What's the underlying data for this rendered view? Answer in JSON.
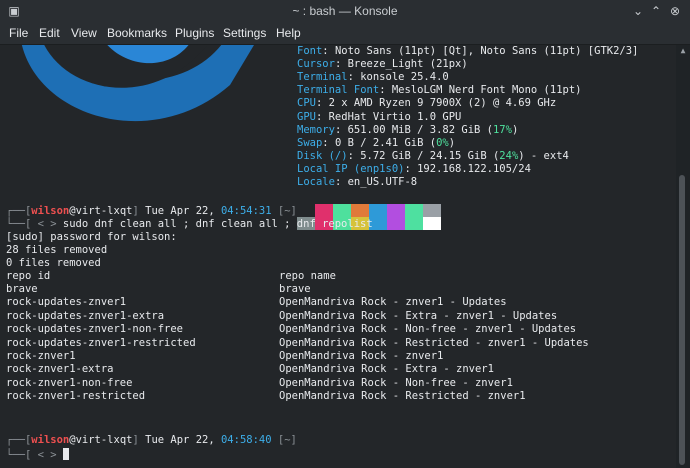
{
  "window": {
    "title": "~ : bash — Konsole"
  },
  "menu": [
    "File",
    "Edit",
    "View",
    "Bookmarks",
    "Plugins",
    "Settings",
    "Help"
  ],
  "fetch": [
    {
      "key": "Font",
      "value": ": Noto Sans (11pt) [Qt], Noto Sans (11pt) [GTK2/3]"
    },
    {
      "key": "Cursor",
      "value": ": Breeze_Light (21px)"
    },
    {
      "key": "Terminal",
      "value": ": konsole 25.4.0"
    },
    {
      "key": "Terminal Font",
      "value": ": MesloLGM Nerd Font Mono (11pt)"
    },
    {
      "key": "CPU",
      "value": ": 2 x AMD Ryzen 9 7900X (2) @ 4.69 GHz"
    },
    {
      "key": "GPU",
      "value": ": RedHat Virtio 1.0 GPU"
    },
    {
      "key": "Memory",
      "value": ": 651.00 MiB / 3.82 GiB (",
      "pct": "17%",
      "tail": ")"
    },
    {
      "key": "Swap",
      "value": ": 0 B / 2.41 GiB (",
      "pct": "0%",
      "tail": ")"
    },
    {
      "key": "Disk (/)",
      "value": ": 5.72 GiB / 24.15 GiB (",
      "pct": "24%",
      "tail": ") - ext4"
    },
    {
      "key": "Local IP (enp1s0)",
      "value": ": 192.168.122.105/24"
    },
    {
      "key": "Locale",
      "value": ": en_US.UTF-8"
    }
  ],
  "palette": {
    "top": [
      "#232629",
      "#e0306c",
      "#4ee09d",
      "#e07a3a",
      "#2e9ad8",
      "#b24ee0",
      "#4ee0a0",
      "#9aa0a6"
    ],
    "bottom": [
      "#7f8c8d",
      "#e0306c",
      "#4ee09d",
      "#d6c23a",
      "#2e9ad8",
      "#b24ee0",
      "#4ee0a0",
      "#ffffff"
    ]
  },
  "prompt1": {
    "corner": "┌──[",
    "user": "wilson",
    "at": "@",
    "host": "virt-lxqt",
    "close": "]",
    "date": " Tue Apr 22, ",
    "time": "04:54:31",
    "dir": " [~]",
    "cmd_prefix": "└──[ < > ",
    "cmd": "sudo dnf clean all ; dnf clean all ; dnf repolist"
  },
  "output": [
    "[sudo] password for wilson:",
    "28 files removed",
    "0 files removed"
  ],
  "repolist": {
    "header": {
      "id": "repo id",
      "name": "repo name"
    },
    "rows": [
      {
        "id": "brave",
        "name": "brave"
      },
      {
        "id": "rock-updates-znver1",
        "name": "OpenMandriva Rock - znver1 - Updates"
      },
      {
        "id": "rock-updates-znver1-extra",
        "name": "OpenMandriva Rock - Extra - znver1 - Updates"
      },
      {
        "id": "rock-updates-znver1-non-free",
        "name": "OpenMandriva Rock - Non-free - znver1 - Updates"
      },
      {
        "id": "rock-updates-znver1-restricted",
        "name": "OpenMandriva Rock - Restricted - znver1 - Updates"
      },
      {
        "id": "rock-znver1",
        "name": "OpenMandriva Rock - znver1"
      },
      {
        "id": "rock-znver1-extra",
        "name": "OpenMandriva Rock - Extra - znver1"
      },
      {
        "id": "rock-znver1-non-free",
        "name": "OpenMandriva Rock - Non-free - znver1"
      },
      {
        "id": "rock-znver1-restricted",
        "name": "OpenMandriva Rock - Restricted - znver1"
      }
    ]
  },
  "prompt2": {
    "corner": "┌──[",
    "user": "wilson",
    "at": "@",
    "host": "virt-lxqt",
    "close": "]",
    "date": " Tue Apr 22, ",
    "time": "04:58:40",
    "dir": " [~]",
    "cmd_prefix": "└──[ < > "
  },
  "colors": {
    "accent": "#3daee9",
    "user": "#ee5050",
    "percent": "#4ee09d",
    "background": "#232629"
  }
}
